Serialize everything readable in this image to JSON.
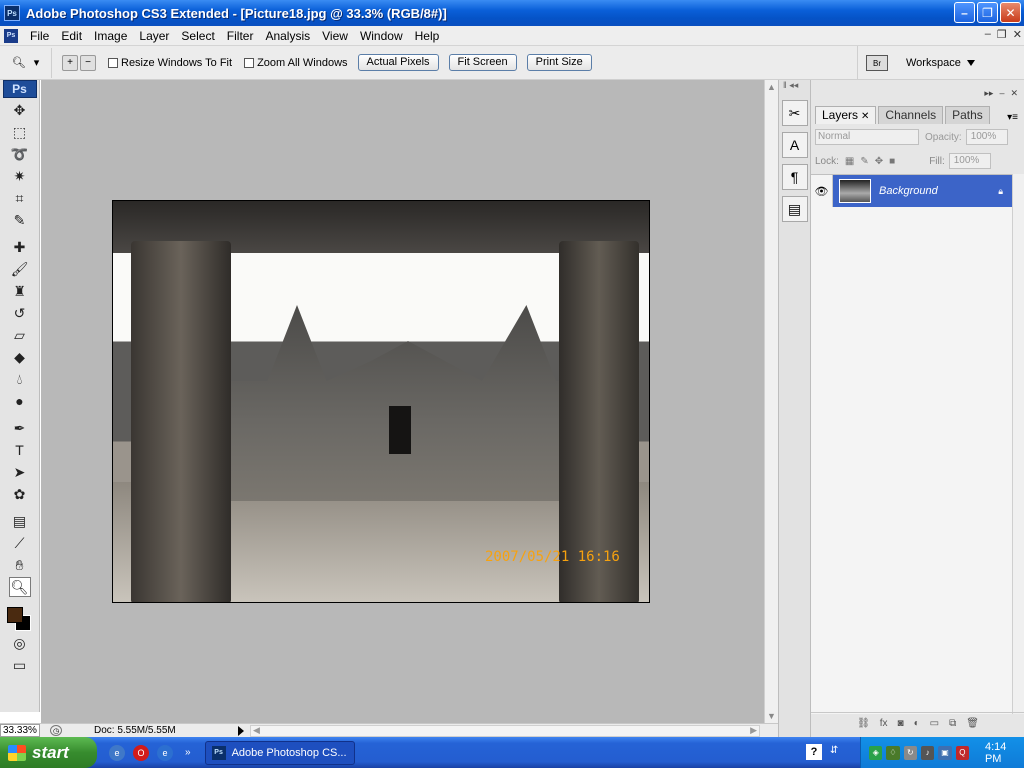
{
  "window": {
    "title": "Adobe Photoshop CS3 Extended - [Picture18.jpg @ 33.3% (RGB/8#)]",
    "app_icon": "Ps",
    "controls": [
      "minimize-icon",
      "maximize-icon",
      "close-icon"
    ]
  },
  "menu": {
    "items": [
      "File",
      "Edit",
      "Image",
      "Layer",
      "Select",
      "Filter",
      "Analysis",
      "View",
      "Window",
      "Help"
    ]
  },
  "options": {
    "resize_windows": "Resize Windows To Fit",
    "zoom_all": "Zoom All Windows",
    "actual_pixels": "Actual Pixels",
    "fit_screen": "Fit Screen",
    "print_size": "Print Size",
    "workspace": "Workspace"
  },
  "tools": {
    "logo": "Ps",
    "items": [
      "move-tool",
      "marquee-tool",
      "lasso-tool",
      "magic-wand-tool",
      "crop-tool",
      "slice-tool",
      "healing-brush-tool",
      "brush-tool",
      "clone-stamp-tool",
      "history-brush-tool",
      "eraser-tool",
      "paint-bucket-tool",
      "blur-tool",
      "dodge-tool",
      "pen-tool",
      "type-tool",
      "path-selection-tool",
      "custom-shape-tool",
      "notes-tool",
      "eyedropper-tool",
      "hand-tool",
      "zoom-tool"
    ],
    "foreground_color": "#4a2a10",
    "background_color": "#000000"
  },
  "canvas": {
    "photo_datestamp": "2007/05/21  16:16"
  },
  "status": {
    "zoom": "33.33%",
    "doc_info": "Doc: 5.55M/5.55M"
  },
  "layers_panel": {
    "tabs": [
      "Layers",
      "Channels",
      "Paths"
    ],
    "blend_mode": "Normal",
    "opacity_label": "Opacity:",
    "opacity_value": "100%",
    "lock_label": "Lock:",
    "fill_label": "Fill:",
    "fill_value": "100%",
    "layers": [
      {
        "name": "Background",
        "visible": true,
        "locked": true
      }
    ]
  },
  "taskbar": {
    "start_label": "start",
    "task_label": "Adobe Photoshop CS...",
    "task_icon": "Ps",
    "help_icon": "?",
    "clock": "4:14 PM"
  }
}
